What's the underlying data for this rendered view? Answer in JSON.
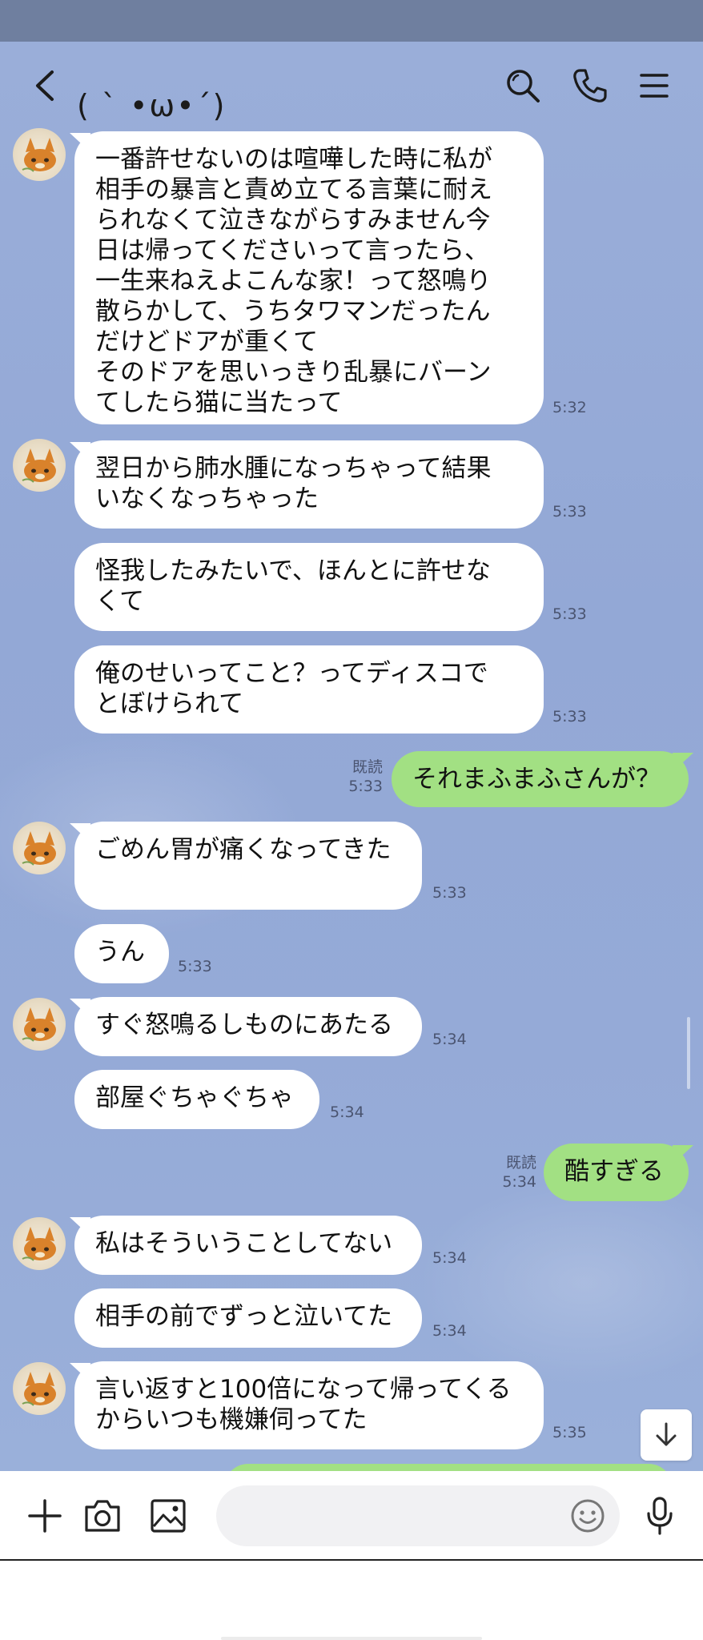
{
  "header": {
    "title": "( ` •ω•´)",
    "back_icon": "chevron-left-icon",
    "search_icon": "search-icon",
    "call_icon": "phone-icon",
    "menu_icon": "menu-icon"
  },
  "colors": {
    "chat_background": "#95aad7",
    "header_bar": "#6f7f9f",
    "own_bubble": "#a2e083",
    "other_bubble": "#ffffff"
  },
  "messages": [
    {
      "sender": "other",
      "text": "一番許せないのは喧嘩した時に私が\n相手の暴言と責め立てる言葉に耐え\nられなくて泣きながらすみません今\n日は帰ってくださいって言ったら、\n一生来ねえよこんな家！って怒鳴り\n散らかして、うちタワマンだったん\nだけどドアが重くて\nそのドアを思いっきり乱暴にバーン\nてしたら猫に当たって",
      "time": "5:32"
    },
    {
      "sender": "other",
      "text": "翌日から肺水腫になっちゃって結果\nいなくなっちゃった",
      "time": "5:33"
    },
    {
      "sender": "other",
      "text": "怪我したみたいで、ほんとに許せな\nくて",
      "time": "5:33"
    },
    {
      "sender": "other",
      "text": "俺のせいってこと？ってディスコで\nとぼけられて",
      "time": "5:33"
    },
    {
      "sender": "me",
      "text": "それまふまふさんが？",
      "time": "5:33",
      "read": "既読"
    },
    {
      "sender": "other",
      "text": "ごめん胃が痛くなってきた\n",
      "time": "5:33"
    },
    {
      "sender": "other",
      "text": "うん",
      "time": "5:33"
    },
    {
      "sender": "other",
      "text": "すぐ怒鳴るしものにあたる",
      "time": "5:34"
    },
    {
      "sender": "other",
      "text": "部屋ぐちゃぐちゃ",
      "time": "5:34"
    },
    {
      "sender": "me",
      "text": "酷すぎる",
      "time": "5:34",
      "read": "既読"
    },
    {
      "sender": "other",
      "text": "私はそういうことしてない",
      "time": "5:34"
    },
    {
      "sender": "other",
      "text": "相手の前でずっと泣いてた",
      "time": "5:34"
    },
    {
      "sender": "other",
      "text": "言い返すと100倍になって帰ってくる\nからいつも機嫌伺ってた",
      "time": "5:35"
    }
  ],
  "input": {
    "placeholder": "",
    "plus_icon": "plus-icon",
    "camera_icon": "camera-icon",
    "image_icon": "image-icon",
    "emoji_icon": "emoji-icon",
    "mic_icon": "microphone-icon",
    "scroll_down_icon": "arrow-down-icon"
  }
}
